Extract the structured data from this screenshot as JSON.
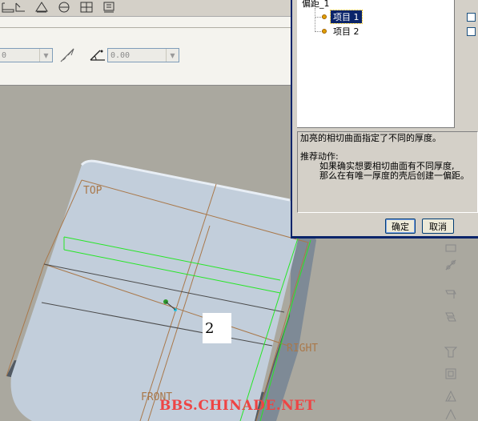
{
  "toolbar": {
    "icons": [
      "dimension-icon",
      "triangle-icon",
      "datum-plane-icon",
      "grid-icon",
      "datum-point-icon"
    ]
  },
  "dashboard": {
    "thickness_value": "0",
    "angle_value": "0.00"
  },
  "dialog": {
    "tree_root": "偏距_1",
    "items": [
      {
        "label": "项目 1",
        "selected": true
      },
      {
        "label": "项目 2",
        "selected": false
      }
    ],
    "message_line1": "加亮的相切曲面指定了不同的厚度。",
    "message_heading": "推荐动作:",
    "message_line2": "如果确实想要相切曲面有不同厚度,",
    "message_line3": "那么在有唯一厚度的壳后创建一偏距。",
    "ok_label": "确定",
    "cancel_label": "取消"
  },
  "viewport": {
    "datum_top": "TOP",
    "datum_right": "RIGHT",
    "datum_front": "FRONT",
    "callout_number": "2",
    "watermark": "BBS.CHINADE.NET"
  },
  "colors": {
    "viewport_bg": "#aaa89f",
    "part_face": "#c2cedb",
    "datum_line": "#a9784a",
    "highlight": "#26e626",
    "dialog_frame": "#0a246a"
  }
}
